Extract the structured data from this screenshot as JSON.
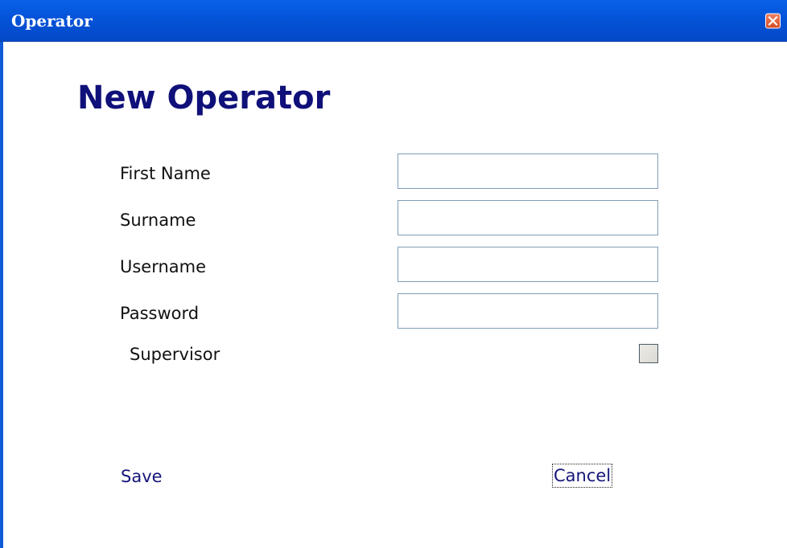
{
  "window": {
    "title": "Operator"
  },
  "form": {
    "heading": "New Operator",
    "fields": {
      "first_name": {
        "label": "First Name",
        "value": ""
      },
      "surname": {
        "label": "Surname",
        "value": ""
      },
      "username": {
        "label": "Username",
        "value": ""
      },
      "password": {
        "label": "Password",
        "value": ""
      }
    },
    "supervisor": {
      "label": "Supervisor",
      "checked": false
    },
    "actions": {
      "save_label": "Save",
      "cancel_label": "Cancel"
    }
  },
  "colors": {
    "titlebar": "#0453d8",
    "heading": "#10107a",
    "link": "#16167a",
    "close_button": "#d84a24",
    "field_border": "#7f9db9"
  },
  "icons": {
    "close": "close-icon"
  }
}
